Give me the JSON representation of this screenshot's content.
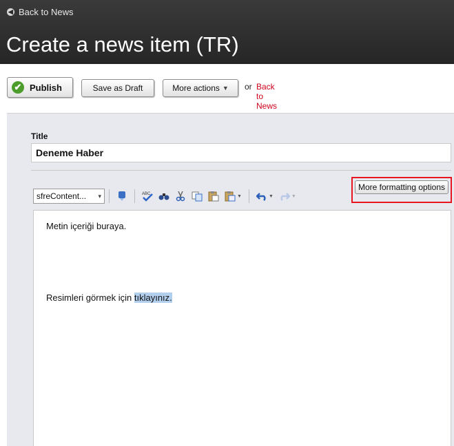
{
  "header": {
    "back_link": "Back to News",
    "title": "Create a news item (TR)"
  },
  "actions": {
    "publish": "Publish",
    "save_draft": "Save as Draft",
    "more_actions": "More actions",
    "or_text": "or",
    "back_link": "Back to News"
  },
  "form": {
    "title_label": "Title",
    "title_value": "Deneme Haber"
  },
  "toolbar": {
    "style_select": "sfreContent...",
    "more_formatting": "More formatting options",
    "icons": [
      "insert-image-icon",
      "spellcheck-icon",
      "find-icon",
      "cut-icon",
      "copy-icon",
      "paste-icon",
      "paste-special-icon",
      "undo-icon",
      "redo-icon"
    ]
  },
  "editor": {
    "line1": "Metin içeriği buraya.",
    "line2_prefix": "Resimleri görmek için ",
    "line2_link": "tıklayınız."
  },
  "colors": {
    "header_bg": "#2e2e2e",
    "panel_bg": "#e7e9ee",
    "link_red": "#d0021b",
    "highlight_red": "#e8141f",
    "selection": "#b3cfee"
  }
}
